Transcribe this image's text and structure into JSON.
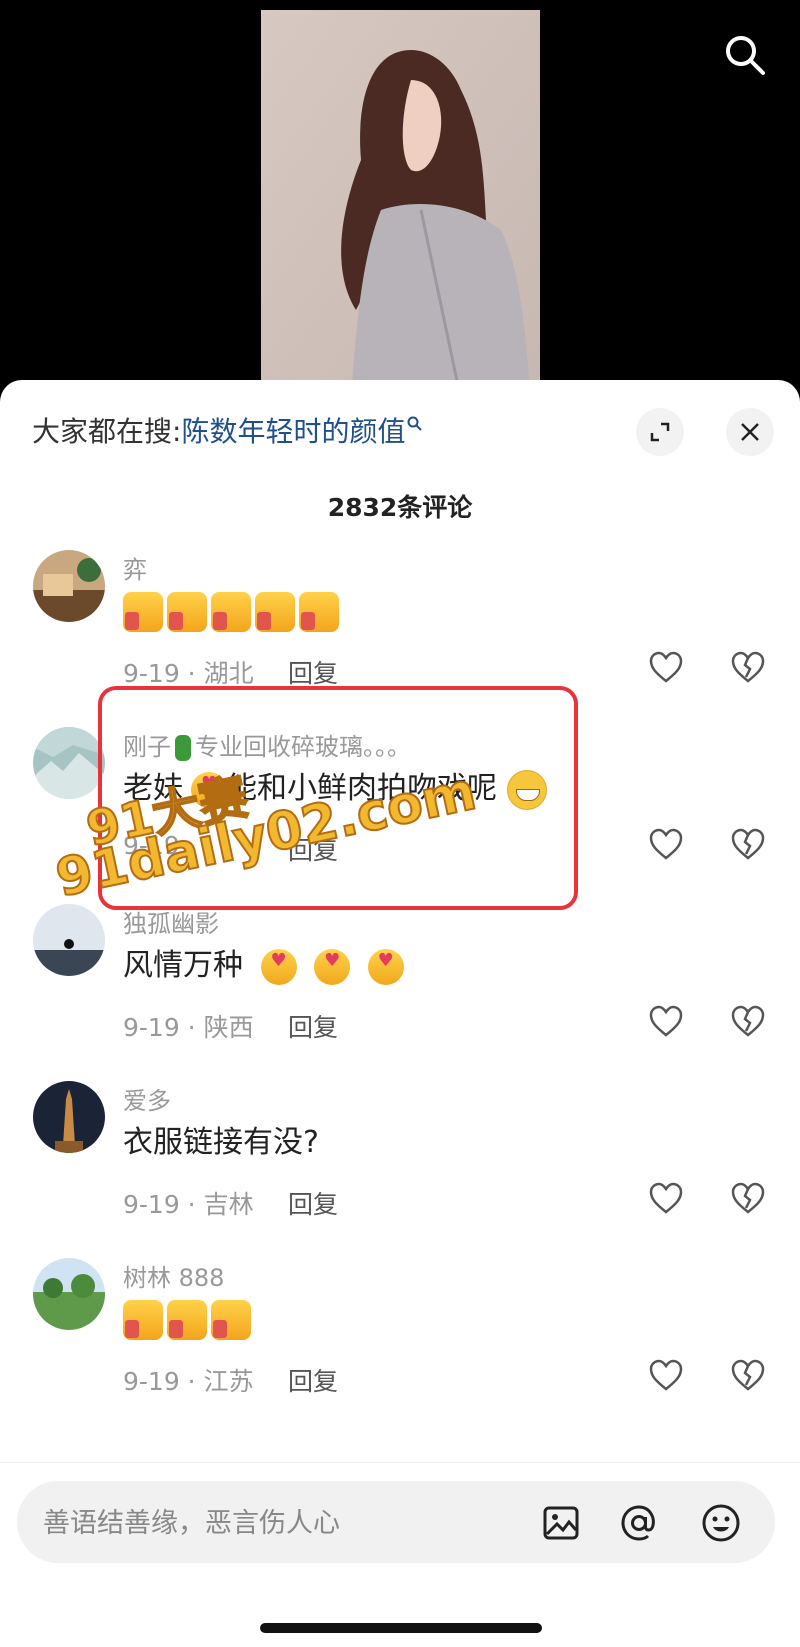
{
  "header": {
    "hot_search_label": "大家都在搜:",
    "hot_search_term": "陈数年轻时的颜值",
    "icons": [
      "search-icon",
      "expand-icon",
      "close-icon"
    ]
  },
  "comment_count": "2832条评论",
  "comments": [
    {
      "user": "弈",
      "text": "",
      "emoji": "thumbs-up x5",
      "meta": "9-19 · 湖北",
      "reply": "回复"
    },
    {
      "user": "刚子",
      "user_suffix": "专业回收碎玻璃。。。",
      "text_before": "老妹",
      "text_after": "能和小鲜肉拍吻戏呢",
      "meta": "9-19 ·",
      "reply": "回复"
    },
    {
      "user": "独孤幽影",
      "text": "风情万种",
      "emoji": "finger-heart x3",
      "meta": "9-19 · 陕西",
      "reply": "回复"
    },
    {
      "user": "爱多",
      "text": "衣服链接有没?",
      "meta": "9-19 · 吉林",
      "reply": "回复"
    },
    {
      "user": "树林 888",
      "text": "",
      "emoji": "thumbs-up x3",
      "meta": "9-19 · 江苏",
      "reply": "回复"
    }
  ],
  "watermark": {
    "line1": "91大赛",
    "line2": "91daily02.com"
  },
  "composer": {
    "placeholder": "善语结善缘，恶言伤人心"
  },
  "colors": {
    "hot_search_term": "#1f4f8c",
    "highlight_box": "#e8333b",
    "watermark": "#f2b830"
  }
}
